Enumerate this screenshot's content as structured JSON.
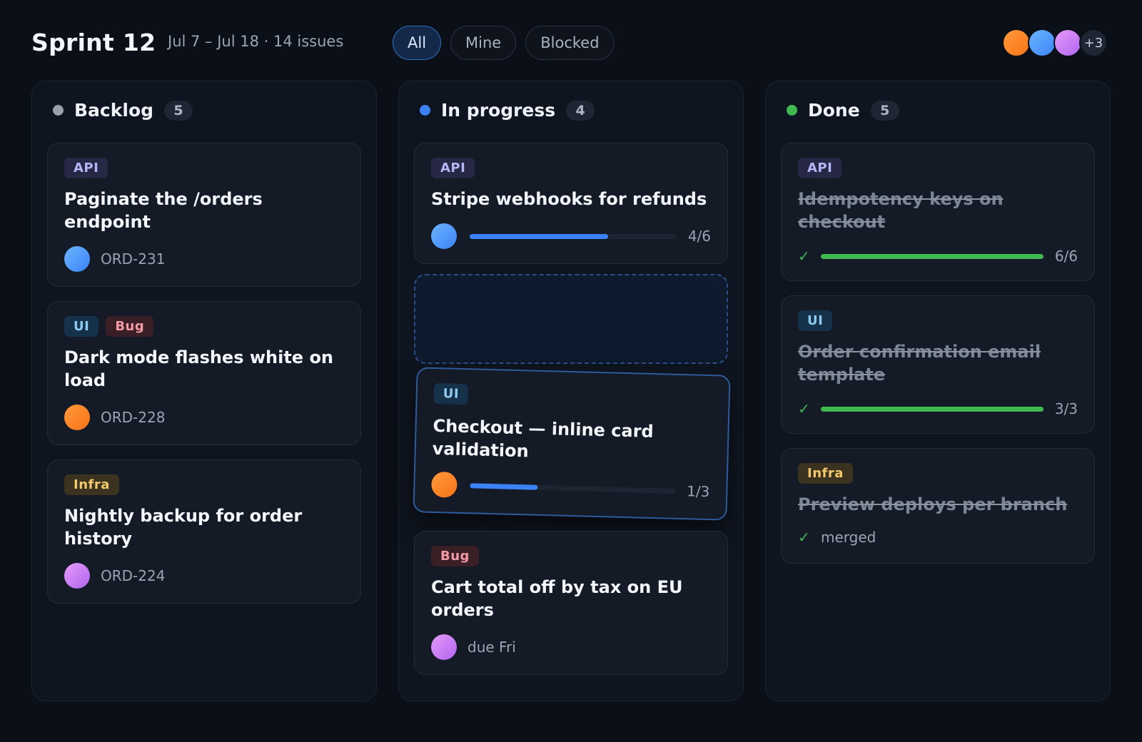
{
  "header": {
    "title": "Sprint 12",
    "subtitle": "Jul 7 – Jul 18 · 14 issues",
    "filters": [
      "All",
      "Mine",
      "Blocked"
    ],
    "active_filter": "All",
    "avatars_more": "+3"
  },
  "colors": {
    "backlog": "#9aa0a8",
    "in_progress": "#3b82f6",
    "done": "#3fb950"
  },
  "columns": [
    {
      "title": "Backlog",
      "count": "5",
      "cards": [
        {
          "tags": [
            "API"
          ],
          "title": "Paginate the /orders endpoint",
          "meta": "ORD-231",
          "avatar": "blue"
        },
        {
          "tags": [
            "UI",
            "Bug"
          ],
          "title": "Dark mode flashes white on load",
          "meta": "ORD-228",
          "avatar": "orange"
        },
        {
          "tags": [
            "Infra"
          ],
          "title": "Nightly backup for order history",
          "meta": "ORD-224",
          "avatar": "purple"
        }
      ]
    },
    {
      "title": "In progress",
      "count": "4",
      "cards": [
        {
          "tags": [
            "API"
          ],
          "title": "Stripe webhooks for refunds",
          "progress_label": "4/6",
          "progress": 0.67,
          "avatar": "blue"
        },
        {
          "tags": [
            "UI"
          ],
          "title": "Checkout — inline card validation",
          "progress_label": "1/3",
          "progress": 0.33,
          "avatar": "orange",
          "state": "dragging"
        },
        {
          "tags": [
            "Bug"
          ],
          "title": "Cart total off by tax on EU orders",
          "meta": "due Fri",
          "avatar": "purple"
        }
      ]
    },
    {
      "title": "Done",
      "count": "5",
      "cards": [
        {
          "tags": [
            "API"
          ],
          "title": "Idempotency keys on checkout",
          "progress_label": "6/6",
          "progress": 1.0,
          "check": "✓"
        },
        {
          "tags": [
            "UI"
          ],
          "title": "Order confirmation email template",
          "progress_label": "3/3",
          "progress": 1.0,
          "check": "✓"
        },
        {
          "tags": [
            "Infra"
          ],
          "title": "Preview deploys per branch",
          "meta": "merged",
          "check": "✓"
        }
      ]
    }
  ]
}
